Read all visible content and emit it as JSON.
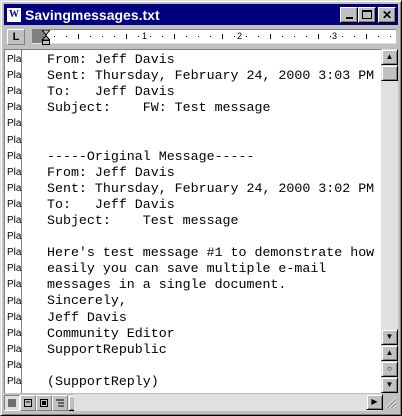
{
  "window": {
    "title": "Savingmessages.txt",
    "app_icon_letter": "W"
  },
  "title_buttons": {
    "minimize": "minimize",
    "maximize": "maximize",
    "close": "✕"
  },
  "ruler": {
    "tab_selector": "L",
    "numbers": [
      "1",
      "2",
      "3"
    ]
  },
  "style_labels": [
    "Pla",
    "Pla",
    "Pla",
    "Pla",
    "Pla",
    "Pla",
    "Pla",
    "Pla",
    "Pla",
    "Pla",
    "Pla",
    "Pla",
    "Pla",
    "Pla",
    "Pla",
    "Pla",
    "Pla",
    "Pla",
    "Pla",
    "Pla",
    "Pla"
  ],
  "document": {
    "lines": [
      "From: Jeff Davis",
      "Sent: Thursday, February 24, 2000 3:03 PM",
      "To:   Jeff Davis",
      "Subject:    FW: Test message",
      "",
      "",
      "-----Original Message-----",
      "From: Jeff Davis",
      "Sent: Thursday, February 24, 2000 3:02 PM",
      "To:   Jeff Davis",
      "Subject:    Test message",
      "",
      "Here's test message #1 to demonstrate how",
      "easily you can save multiple e-mail",
      "messages in a single document.",
      "Sincerely,",
      "Jeff Davis",
      "Community Editor",
      "SupportRepublic",
      "",
      "(SupportReply)"
    ]
  },
  "scrollbar": {
    "up": "▲",
    "down": "▼",
    "prev_page": "▲",
    "select_browse": "○",
    "next_page": "▼",
    "left": "◀",
    "right": "▶"
  },
  "view_buttons": [
    "normal-view",
    "web-layout-view",
    "print-layout-view",
    "outline-view"
  ]
}
